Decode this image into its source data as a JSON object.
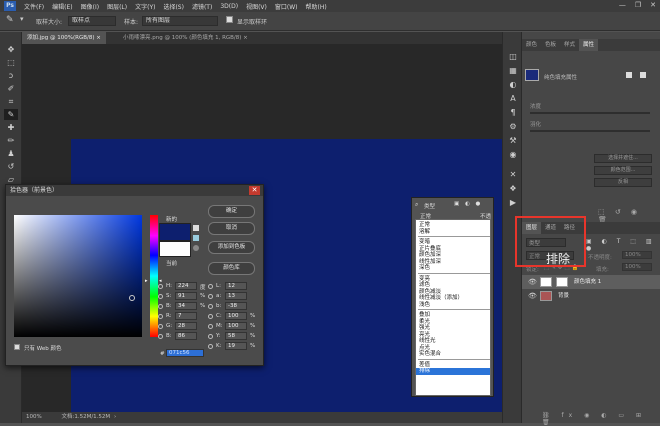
{
  "menu": [
    "文件(F)",
    "编辑(E)",
    "图像(I)",
    "图层(L)",
    "文字(Y)",
    "选择(S)",
    "滤镜(T)",
    "3D(D)",
    "视图(V)",
    "窗口(W)",
    "帮助(H)"
  ],
  "app_logo": "Ps",
  "window_controls": [
    "—",
    "❐",
    "✕"
  ],
  "options": {
    "sample_size_label": "取样大小:",
    "sample_size_value": "取样点",
    "sample_label": "样本:",
    "sample_value": "所有图层",
    "show_ring_label": "显示取样环"
  },
  "doc_tabs": [
    "添加.jpg @ 100%(RGB/8) ×",
    "小雨嗦漂亮.png @ 100% (颜色填充 1, RGB/8) ×"
  ],
  "status": {
    "zoom": "100%",
    "doc_info": "文档:1.52M/1.52M"
  },
  "right_panels": {
    "top_tabs": [
      "颜色",
      "色板",
      "样式",
      "属性"
    ],
    "top_active": 3,
    "props_layer_label": "纯色填充属性",
    "props_label_a": "浓度",
    "props_label_b": "羽化",
    "props_buttons": [
      "选择并遮住...",
      "颜色范围...",
      "反相"
    ],
    "layer_tabs": [
      "图层",
      "通道",
      "路径"
    ],
    "layer_active": 0,
    "filter_kind": "类型",
    "blend_mode_value": "正常",
    "opacity_label": "不透明度:",
    "opacity_value": "100%",
    "lock_label": "锁定:",
    "fill_label": "填充:",
    "fill_value": "100%",
    "annotation": "排除",
    "layers": [
      {
        "name": "颜色填充 1"
      },
      {
        "name": "背景"
      }
    ]
  },
  "picker": {
    "title": "拾色器（前景色）",
    "new_label": "新的",
    "current_label": "当前",
    "new_color": "#0D1F6E",
    "current_color": "#FFFFFF",
    "btn_ok": "确定",
    "btn_cancel": "取消",
    "btn_add_swatch": "添加到色板",
    "btn_libraries": "颜色库",
    "web_only": "只有 Web 颜色",
    "fields_left": [
      {
        "key": "H:",
        "value": "224",
        "unit": "度"
      },
      {
        "key": "S:",
        "value": "91",
        "unit": "%"
      },
      {
        "key": "B:",
        "value": "34",
        "unit": "%"
      },
      {
        "key": "R:",
        "value": "7",
        "unit": ""
      },
      {
        "key": "G:",
        "value": "28",
        "unit": ""
      },
      {
        "key": "B:",
        "value": "86",
        "unit": ""
      }
    ],
    "fields_right": [
      {
        "key": "L:",
        "value": "12",
        "unit": ""
      },
      {
        "key": "a:",
        "value": "13",
        "unit": ""
      },
      {
        "key": "b:",
        "value": "-38",
        "unit": ""
      },
      {
        "key": "C:",
        "value": "100",
        "unit": "%"
      },
      {
        "key": "M:",
        "value": "100",
        "unit": "%"
      },
      {
        "key": "Y:",
        "value": "58",
        "unit": "%"
      },
      {
        "key": "K:",
        "value": "19",
        "unit": "%"
      }
    ],
    "hex_label": "#",
    "hex_value": "071c56"
  },
  "blend_menu": {
    "kind_label": "类型",
    "mode_label": "正常",
    "opacity_short": "不透",
    "groups": [
      [
        "正常",
        "溶解"
      ],
      [
        "变暗",
        "正片叠底",
        "颜色加深",
        "线性加深",
        "深色"
      ],
      [
        "变亮",
        "滤色",
        "颜色减淡",
        "线性减淡（添加）",
        "浅色"
      ],
      [
        "叠加",
        "柔光",
        "强光",
        "亮光",
        "线性光",
        "点光",
        "实色混合"
      ],
      [
        "差值",
        "排除"
      ]
    ],
    "selected": "排除"
  }
}
